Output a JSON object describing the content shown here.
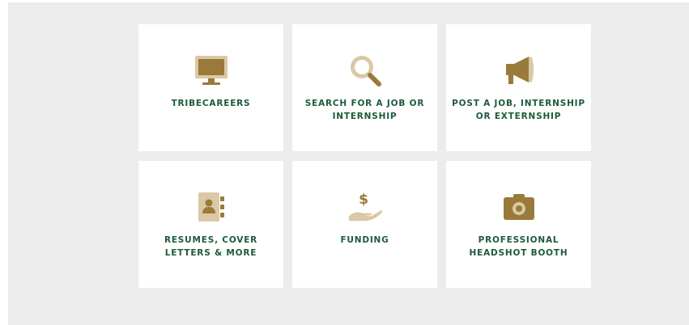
{
  "tiles": [
    {
      "label": "TRIBECAREERS",
      "icon": "monitor-icon"
    },
    {
      "label": "SEARCH FOR A JOB OR\nINTERNSHIP",
      "icon": "search-icon"
    },
    {
      "label": "POST A JOB, INTERNSHIP\nOR EXTERNSHIP",
      "icon": "megaphone-icon"
    },
    {
      "label": "RESUMES, COVER\nLETTERS & MORE",
      "icon": "address-book-icon"
    },
    {
      "label": "FUNDING",
      "icon": "money-hand-icon"
    },
    {
      "label": "PROFESSIONAL\nHEADSHOT BOOTH",
      "icon": "camera-icon"
    }
  ],
  "colors": {
    "label": "#1d5a3a",
    "icon_dark": "#9a7a3a",
    "icon_light": "#dac8a6",
    "background": "#ececec",
    "tile": "#ffffff"
  }
}
